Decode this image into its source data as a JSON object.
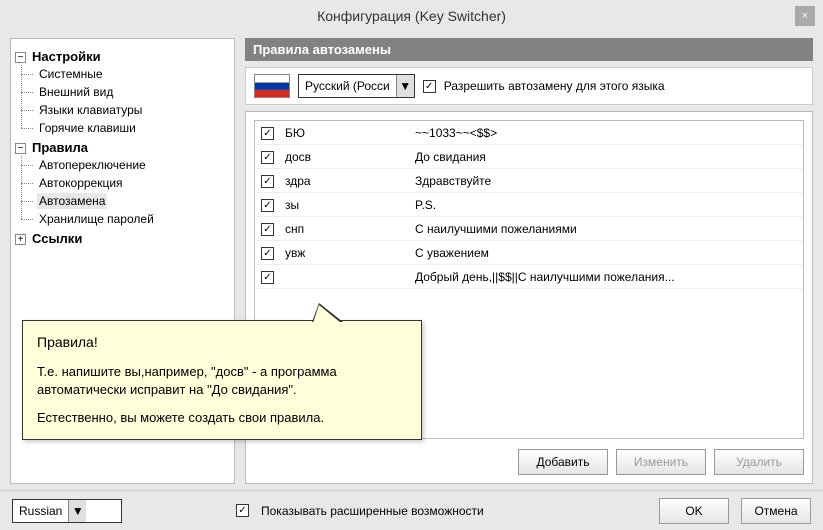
{
  "window": {
    "title": "Конфигурация (Key Switcher)"
  },
  "tree": {
    "settings": {
      "label": "Настройки",
      "children": [
        "Системные",
        "Внешний вид",
        "Языки клавиатуры",
        "Горячие клавиши"
      ]
    },
    "rules": {
      "label": "Правила",
      "children": [
        "Автопереключение",
        "Автокоррекция",
        "Автозамена",
        "Хранилище паролей"
      ],
      "selected_index": 2
    },
    "links": {
      "label": "Ссылки"
    }
  },
  "section": {
    "title": "Правила автозамены"
  },
  "language": {
    "combo_value": "Русский (Росси",
    "allow_label": "Разрешить автозамену для этого языка",
    "allow_checked": true
  },
  "rules_list": [
    {
      "checked": true,
      "abbr": "БЮ",
      "expansion": "~~1033~~<$$>"
    },
    {
      "checked": true,
      "abbr": "досв",
      "expansion": "До свидания"
    },
    {
      "checked": true,
      "abbr": "здра",
      "expansion": "Здравствуйте"
    },
    {
      "checked": true,
      "abbr": "зы",
      "expansion": "P.S."
    },
    {
      "checked": true,
      "abbr": "снп",
      "expansion": "С наилучшими пожеланиями"
    },
    {
      "checked": true,
      "abbr": "увж",
      "expansion": "С уважением"
    },
    {
      "checked": true,
      "abbr": "",
      "expansion": "Добрый день,||$$||С наилучшими пожелания..."
    }
  ],
  "buttons": {
    "add": "Добавить",
    "edit": "Изменить",
    "delete": "Удалить",
    "ok": "OK",
    "cancel": "Отмена"
  },
  "bottom": {
    "lang_select": "Russian",
    "show_advanced": "Показывать расширенные возможности",
    "show_advanced_checked": true
  },
  "tooltip": {
    "title": "Правила!",
    "line1": "Т.е. напишите вы,например, \"досв\" - а программа автоматически исправит на \"До свидания\".",
    "line2": "Естественно, вы можете создать свои правила."
  }
}
